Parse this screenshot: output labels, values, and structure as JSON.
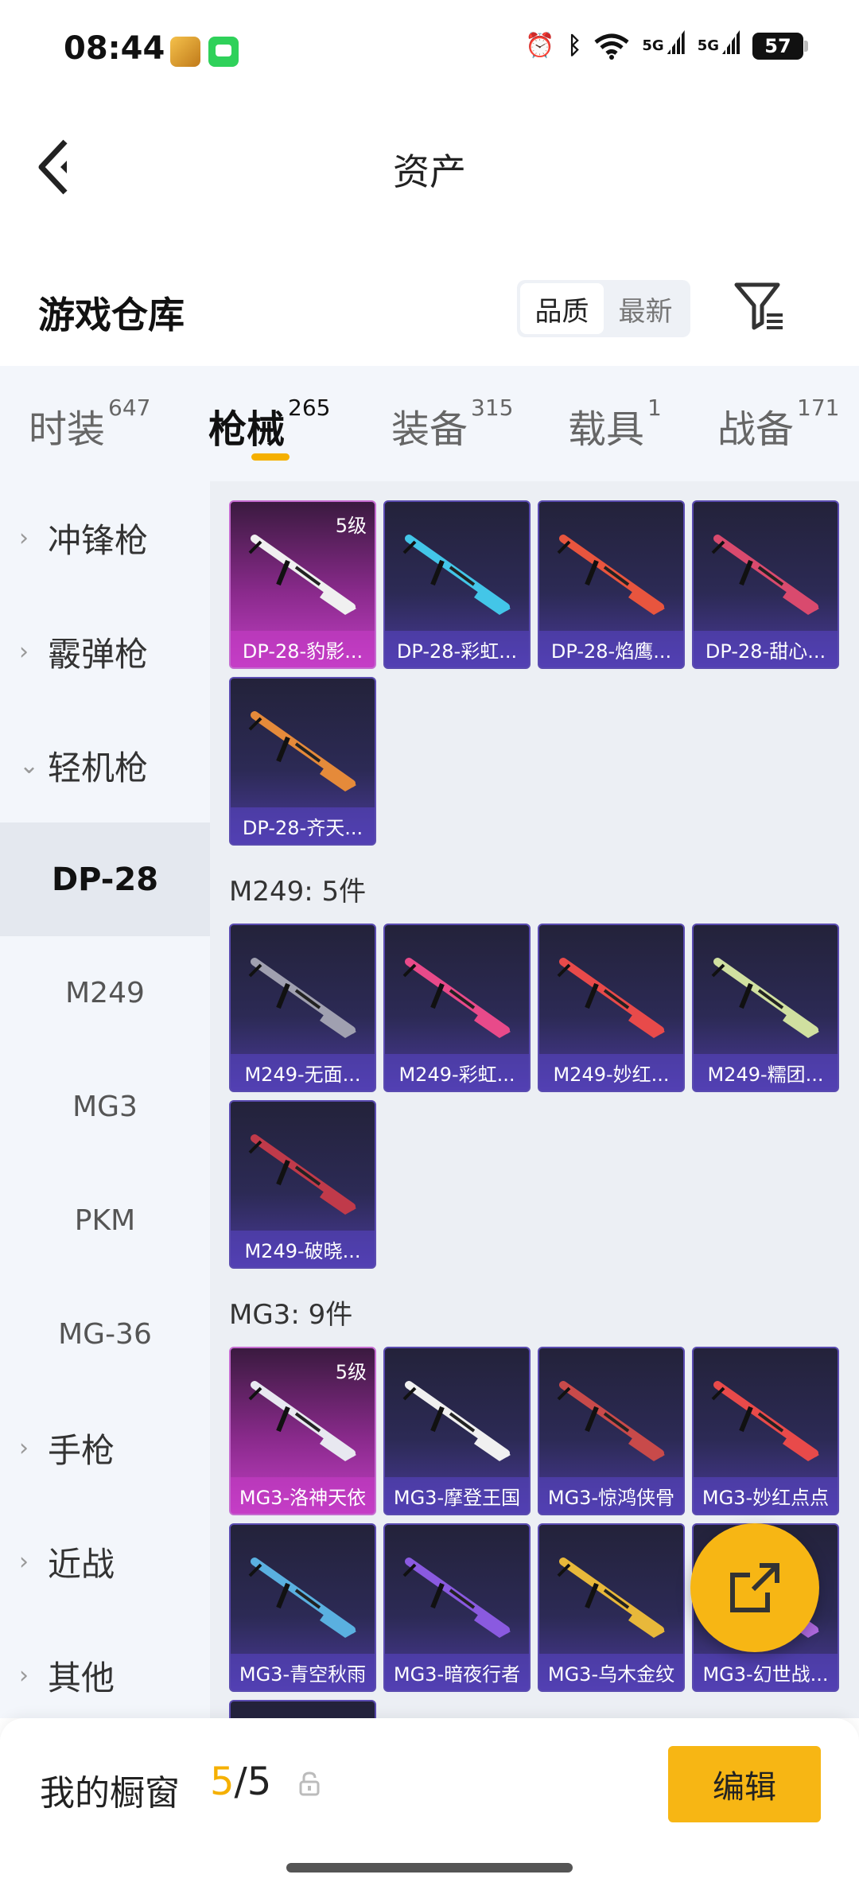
{
  "status": {
    "time": "08:44",
    "signal1": "5G",
    "signal2": "5G",
    "battery": "57"
  },
  "nav": {
    "title": "资产"
  },
  "warehouse": {
    "title": "游戏仓库",
    "sort_options": [
      "品质",
      "最新"
    ]
  },
  "tabs": [
    {
      "label": "时装",
      "count": "647"
    },
    {
      "label": "枪械",
      "count": "265"
    },
    {
      "label": "装备",
      "count": "315"
    },
    {
      "label": "载具",
      "count": "1"
    },
    {
      "label": "战备",
      "count": "171"
    }
  ],
  "sidebar": {
    "categories": [
      "冲锋枪",
      "霰弹枪",
      "轻机枪",
      "手枪",
      "近战",
      "其他"
    ],
    "subitems": [
      "DP-28",
      "M249",
      "MG3",
      "PKM",
      "MG-36"
    ]
  },
  "groups": {
    "dp28": {
      "cards": [
        {
          "name": "DP-28-豹影...",
          "level": "5级"
        },
        {
          "name": "DP-28-彩虹..."
        },
        {
          "name": "DP-28-焰鹰..."
        },
        {
          "name": "DP-28-甜心..."
        },
        {
          "name": "DP-28-齐天..."
        }
      ]
    },
    "m249": {
      "title": "M249: 5件",
      "cards": [
        {
          "name": "M249-无面..."
        },
        {
          "name": "M249-彩虹..."
        },
        {
          "name": "M249-妙红..."
        },
        {
          "name": "M249-糯团..."
        },
        {
          "name": "M249-破晓..."
        }
      ]
    },
    "mg3": {
      "title": "MG3: 9件",
      "cards": [
        {
          "name": "MG3-洛神天依",
          "level": "5级"
        },
        {
          "name": "MG3-摩登王国"
        },
        {
          "name": "MG3-惊鸿侠骨"
        },
        {
          "name": "MG3-妙红点点"
        },
        {
          "name": "MG3-青空秋雨"
        },
        {
          "name": "MG3-暗夜行者"
        },
        {
          "name": "MG3-乌木金纹"
        },
        {
          "name": "MG3-幻世战..."
        }
      ]
    }
  },
  "showcase": {
    "title": "我的橱窗",
    "current": "5",
    "total": "/5",
    "edit_label": "编辑"
  },
  "colors": {
    "accent": "#f5b000",
    "card_purple": "#c13fc4",
    "card_blue": "#4a3a9a"
  }
}
